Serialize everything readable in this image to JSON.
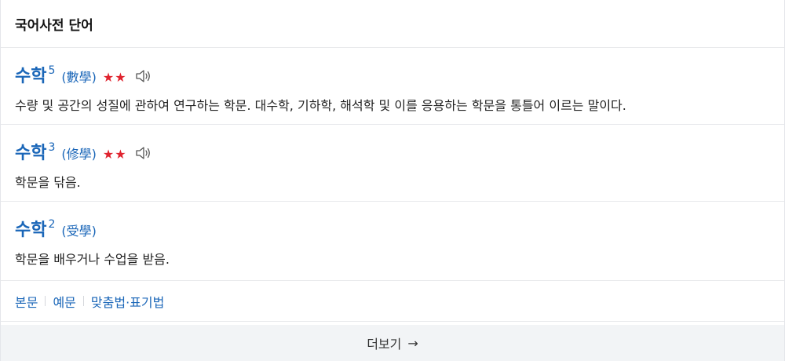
{
  "header": {
    "title": "국어사전 단어"
  },
  "entries": [
    {
      "word": "수학",
      "sup": "5",
      "hanja": "(數學)",
      "stars": "★★",
      "definition": "수량 및 공간의 성질에 관하여 연구하는 학문. 대수학, 기하학, 해석학 및 이를 응용하는 학문을 통틀어 이르는 말이다."
    },
    {
      "word": "수학",
      "sup": "3",
      "hanja": "(修學)",
      "stars": "★★",
      "definition": "학문을 닦음."
    },
    {
      "word": "수학",
      "sup": "2",
      "hanja": "(受學)",
      "definition": "학문을 배우거나 수업을 받음."
    }
  ],
  "links": {
    "main": "본문",
    "examples": "예문",
    "spelling": "맞춤법·표기법"
  },
  "more": {
    "label": "더보기",
    "arrow": "→"
  },
  "colors": {
    "link_blue": "#1a66b8",
    "star_red": "#e0242f",
    "footer_bg": "#f2f4f6"
  },
  "icons": {
    "speaker": "speaker-icon",
    "arrow": "arrow-right-icon"
  }
}
